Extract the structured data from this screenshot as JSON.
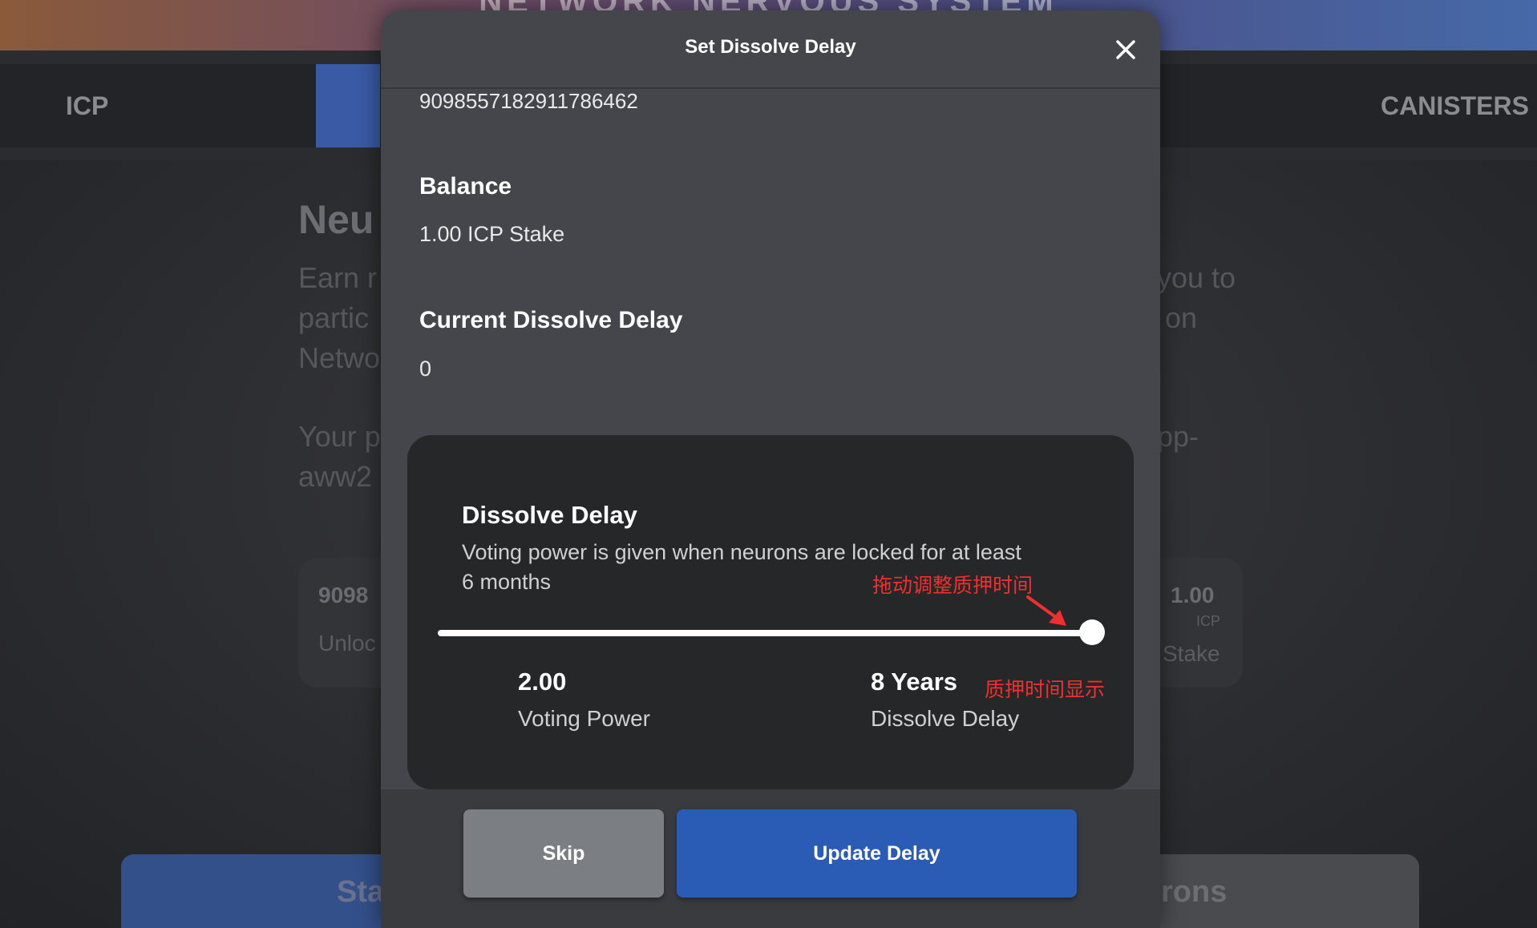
{
  "background": {
    "header_title": "NETWORK NERVOUS SYSTEM",
    "tabs": [
      {
        "label": "ICP"
      },
      {
        "label": "CANISTERS"
      }
    ],
    "heading_fragment": "Neu",
    "para_left": [
      "Earn r",
      "partic",
      "Netwo"
    ],
    "para_right": [
      "you to",
      "on"
    ],
    "para2_left": [
      "Your p",
      "aww2"
    ],
    "para2_right": [
      "pp-"
    ],
    "card": {
      "id_fragment": "9098",
      "state_fragment": "Unloc",
      "amount": "1.00",
      "unit": "ICP",
      "stake_label": "Stake"
    },
    "bottom_left_btn_fragment": "Sta",
    "bottom_right_btn_fragment": "rons"
  },
  "modal": {
    "title": "Set Dissolve Delay",
    "neuron_id": "9098557182911786462",
    "balance_label": "Balance",
    "balance_value": "1.00 ICP Stake",
    "current_delay_label": "Current Dissolve Delay",
    "current_delay_value": "0",
    "delay_card": {
      "title": "Dissolve Delay",
      "description": "Voting power is given when neurons are locked for at least 6 months",
      "slider_fraction": 1.0,
      "voting_power_value": "2.00",
      "voting_power_label": "Voting Power",
      "dissolve_delay_value": "8 Years",
      "dissolve_delay_label": "Dissolve Delay"
    },
    "annotations": {
      "drag_hint": "拖动调整质押时间",
      "display_hint": "质押时间显示",
      "color": "#f02f2f"
    },
    "buttons": {
      "skip": "Skip",
      "update": "Update Delay"
    }
  },
  "colors": {
    "primary_button": "#2a5cb6",
    "secondary_button": "#7b7f83",
    "modal_bg": "#45464b",
    "card_bg": "#262728"
  }
}
